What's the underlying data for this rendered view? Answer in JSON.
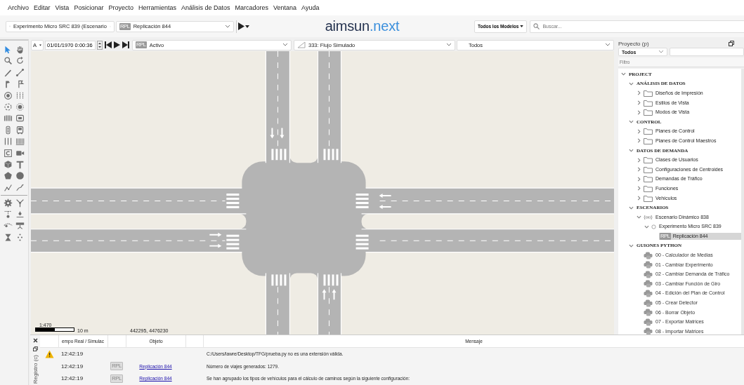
{
  "menu": [
    {
      "label": "Archivo"
    },
    {
      "label": "Editar"
    },
    {
      "label": "Vista"
    },
    {
      "label": "Posicionar"
    },
    {
      "label": "Proyecto"
    },
    {
      "label": "Herramientas"
    },
    {
      "label": "Análisis de Datos"
    },
    {
      "label": "Marcadores"
    },
    {
      "label": "Ventana"
    },
    {
      "label": "Ayuda"
    }
  ],
  "toolbar": {
    "experiment": "Experimento Micro SRC 839 (Escenario",
    "replication_badge": "RPL",
    "replication": "Replicación 844",
    "logo_main": "aimsun",
    "logo_accent": ".next",
    "models_button": "Todos los Modelos",
    "search": {
      "placeholder": "Buscar..."
    }
  },
  "viewer": {
    "layer": "A",
    "time": "01/01/1970 0:00:36",
    "mode_badge": "RPL",
    "mode": "Activo",
    "view_mode": "333: Flujo Simulado",
    "filter": "Todos",
    "scale": "1:470",
    "scale_length": "10 m",
    "coordinates": "442295, 4476230"
  },
  "project_panel": {
    "title": "Proyecto (p)",
    "type_filter": "Todos",
    "filter": {
      "placeholder": "Filtro"
    },
    "tree": [
      {
        "label": "PROJECT",
        "kind": "category",
        "expanded": true,
        "selected": false,
        "children": [
          {
            "label": "ANÁLISIS DE DATOS",
            "kind": "category",
            "expanded": true,
            "selected": false,
            "children": [
              {
                "label": "Diseños de Impresión",
                "kind": "folder",
                "expanded": false,
                "selected": false
              },
              {
                "label": "Estilos de Vista",
                "kind": "folder",
                "expanded": false,
                "selected": false
              },
              {
                "label": "Modos de Vista",
                "kind": "folder",
                "expanded": false,
                "selected": false
              }
            ]
          },
          {
            "label": "CONTROL",
            "kind": "category",
            "expanded": true,
            "selected": false,
            "children": [
              {
                "label": "Planes de Control",
                "kind": "folder",
                "expanded": false,
                "selected": false
              },
              {
                "label": "Planes de Control Maestros",
                "kind": "folder",
                "expanded": false,
                "selected": false
              }
            ]
          },
          {
            "label": "DATOS DE DEMANDA",
            "kind": "category",
            "expanded": true,
            "selected": false,
            "children": [
              {
                "label": "Clases de Usuarios",
                "kind": "folder",
                "expanded": false,
                "selected": false
              },
              {
                "label": "Configuraciones de Centroides",
                "kind": "folder",
                "expanded": false,
                "selected": false
              },
              {
                "label": "Demandas de Tráfico",
                "kind": "folder",
                "expanded": false,
                "selected": false
              },
              {
                "label": "Funciones",
                "kind": "folder",
                "expanded": false,
                "selected": false
              },
              {
                "label": "Vehículos",
                "kind": "folder",
                "expanded": false,
                "selected": false
              }
            ]
          },
          {
            "label": "ESCENARIOS",
            "kind": "category",
            "expanded": true,
            "selected": false,
            "children": [
              {
                "label": "Escenario Dinámico 838",
                "kind": "scenario",
                "expanded": true,
                "selected": false,
                "children": [
                  {
                    "label": "Experimento Micro SRC 839",
                    "kind": "experiment",
                    "expanded": true,
                    "selected": false,
                    "children": [
                      {
                        "label": "Replicación 844",
                        "kind": "replication",
                        "badge": "RPL",
                        "selected": true
                      }
                    ]
                  }
                ]
              }
            ]
          },
          {
            "label": "GUIONES PYTHON",
            "kind": "category",
            "expanded": true,
            "selected": false,
            "children": [
              {
                "label": "00 - Calculador de Medias",
                "kind": "script",
                "selected": false
              },
              {
                "label": "01 - Cambiar Experimento",
                "kind": "script",
                "selected": false
              },
              {
                "label": "02 - Cambiar Demanda de Tráfico",
                "kind": "script",
                "selected": false
              },
              {
                "label": "03 - Cambiar Función de Giro",
                "kind": "script",
                "selected": false
              },
              {
                "label": "04 - Edición del Plan de Control",
                "kind": "script",
                "selected": false
              },
              {
                "label": "05 - Crear Detector",
                "kind": "script",
                "selected": false
              },
              {
                "label": "06 - Borrar Objeto",
                "kind": "script",
                "selected": false
              },
              {
                "label": "07 - Exportar Matrices",
                "kind": "script",
                "selected": false
              },
              {
                "label": "08 - Importar Matrices",
                "kind": "script",
                "selected": false
              }
            ]
          }
        ]
      }
    ]
  },
  "log": {
    "title": "Registro (c)",
    "columns": [
      "empo Real / Simulac",
      "",
      "Objeto",
      "",
      "Mensaje"
    ],
    "rows": [
      {
        "kind": "warning",
        "time": "12:42:19",
        "message": "C:/Users/lawre/Desktop/TFG/prueba.py no es una extensión válida."
      },
      {
        "kind": "info",
        "time": "12:42:19",
        "badge": "RPL",
        "object": "Replicación 844",
        "message": "Número de viajes generados: 1279."
      },
      {
        "kind": "info",
        "time": "12:42:19",
        "badge": "RPL",
        "object": "Replicación 844",
        "message": "Se han agrupado los tipos de vehículos para el cálculo de caminos según la siguiente configuración:"
      }
    ]
  }
}
